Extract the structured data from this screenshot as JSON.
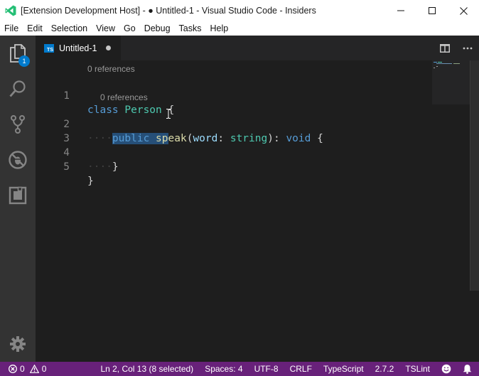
{
  "window": {
    "title": "[Extension Development Host] - ● Untitled-1 - Visual Studio Code - Insiders"
  },
  "menu": [
    "File",
    "Edit",
    "Selection",
    "View",
    "Go",
    "Debug",
    "Tasks",
    "Help"
  ],
  "activity": {
    "explorer_badge": "1",
    "icons": [
      "files-icon",
      "search-icon",
      "source-control-icon",
      "debug-icon",
      "extensions-icon",
      "gear-icon"
    ]
  },
  "tab": {
    "language_badge": "TS",
    "label": "Untitled-1"
  },
  "editor": {
    "lens_class": "0 references",
    "lens_method": "0 references",
    "line_numbers": [
      "1",
      "2",
      "3",
      "4",
      "5"
    ],
    "code": {
      "l1_kw": "class",
      "l1_cls": "Person",
      "l1_brace": "{",
      "l2_ws": "····",
      "l2_public": "public",
      "l2_fn": "speak",
      "l2_open": "(",
      "l2_param": "word",
      "l2_colon": ":",
      "l2_type": "string",
      "l2_close": "):",
      "l2_ret": "void",
      "l2_brace": "{",
      "l4_ws": "····",
      "l4_brace": "}",
      "l5_brace": "}"
    }
  },
  "status": {
    "errors": "0",
    "warnings": "0",
    "position": "Ln 2, Col 13 (8 selected)",
    "spaces": "Spaces: 4",
    "encoding": "UTF-8",
    "eol": "CRLF",
    "language": "TypeScript",
    "version": "2.7.2",
    "linter": "TSLint"
  },
  "colors": {
    "status_bar": "#68217a",
    "accent": "#007acc",
    "selection": "#264f78"
  }
}
